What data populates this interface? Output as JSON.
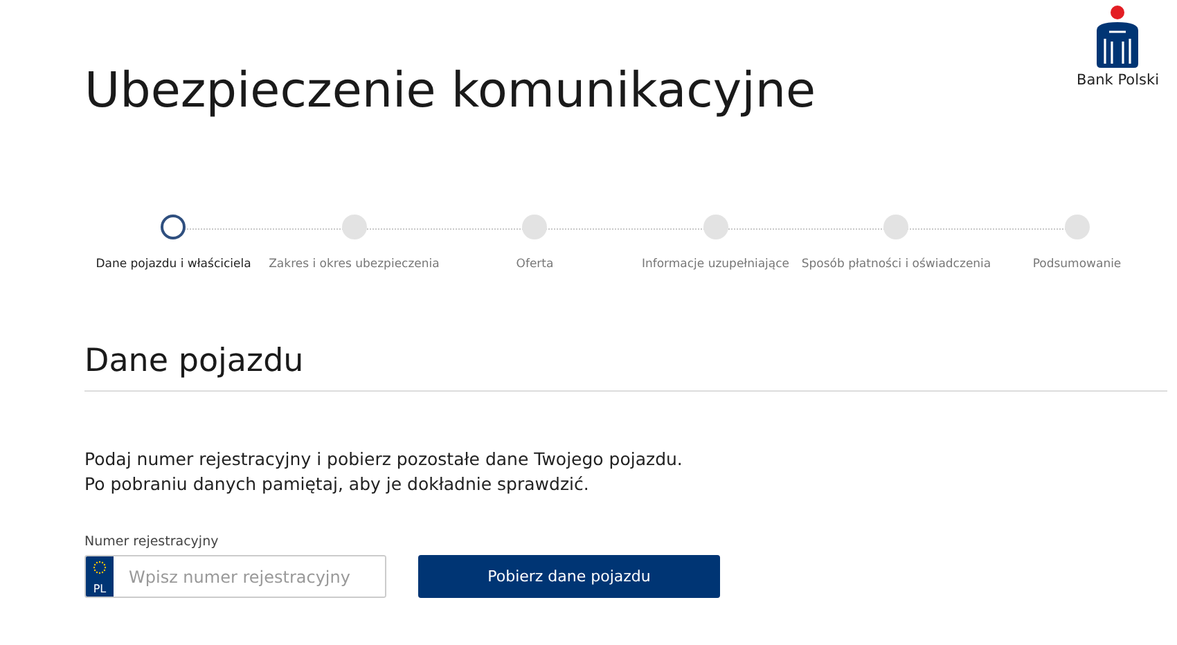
{
  "logo": {
    "caption": "Bank Polski"
  },
  "title": "Ubezpieczenie komunikacyjne",
  "steps": [
    {
      "label": "Dane pojazdu i właściciela",
      "selected": true
    },
    {
      "label": "Zakres i okres ubezpieczenia",
      "selected": false
    },
    {
      "label": "Oferta",
      "selected": false
    },
    {
      "label": "Informacje uzupełniające",
      "selected": false
    },
    {
      "label": "Sposób płatności i oświadczenia",
      "selected": false
    },
    {
      "label": "Podsumowanie",
      "selected": false
    }
  ],
  "section": {
    "title": "Dane pojazdu",
    "intro": [
      "Podaj numer rejestracyjny i pobierz pozostałe dane Twojego pojazdu.",
      "Po pobraniu danych pamiętaj, aby je dokładnie sprawdzić."
    ],
    "field": {
      "label": "Numer rejestracyjny",
      "badge": "PL",
      "placeholder": "Wpisz numer rejestracyjny"
    },
    "button": "Pobierz dane pojazdu"
  }
}
